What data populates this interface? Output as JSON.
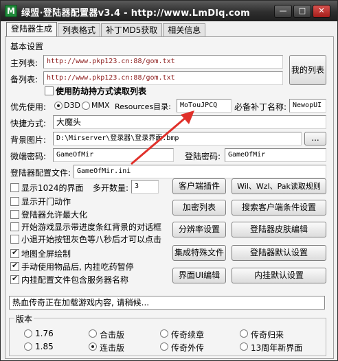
{
  "window": {
    "title": "绿盟·登陆器配置器v3.4 - http://www.LmDlq.com",
    "minimize_glyph": "—",
    "maximize_glyph": "□",
    "close_glyph": "✕",
    "icon_letter": "M"
  },
  "tabs": [
    {
      "label": "登陆器生成",
      "active": true
    },
    {
      "label": "列表格式"
    },
    {
      "label": "补丁MD5获取"
    },
    {
      "label": "相关信息"
    }
  ],
  "basic": {
    "section_label": "基本设置",
    "main_list_label": "主列表:",
    "main_list_value": "http://www.pkp123.cn:88/gom.txt",
    "backup_list_label": "备列表:",
    "backup_list_value": "http://www.pkp123.cn:88/gom.txt",
    "my_list_button": "我的列表",
    "anti_hijack_label": "使用防劫持方式读取列表"
  },
  "priority": {
    "label": "优先使用:",
    "opt1": "D3D",
    "opt2": "MMX",
    "resources_label": "Resources目录:",
    "resources_value": "MoTouJPCQ",
    "patch_label": "必备补丁名称:",
    "patch_value": "NewopUI"
  },
  "shortcut": {
    "label": "快捷方式:",
    "value": "大魔头"
  },
  "background": {
    "label": "背景图片:",
    "value": "D:\\Mirserver\\登录器\\登录界面.bmp",
    "browse": "..."
  },
  "micro_pwd": {
    "label": "微端密码:",
    "value": "GameOfMir"
  },
  "login_pwd": {
    "label": "登陆密码:",
    "value": "GameOfMir"
  },
  "config_file": {
    "label": "登陆器配置文件:",
    "value": "GameOfMir.ini"
  },
  "options": [
    {
      "label": "显示1024的界面",
      "checked": false
    },
    {
      "label": "显示开门动作",
      "checked": false
    },
    {
      "label": "登陆器允许最大化",
      "checked": false
    },
    {
      "label": "开始游戏显示带进度条红背景的对话框",
      "checked": false
    },
    {
      "label": "小退开始按钮灰色等八秒后才可以点击",
      "checked": false
    },
    {
      "label": "地图全屏绘制",
      "checked": true
    },
    {
      "label": "手动使用物品后, 内挂吃药暂停",
      "checked": true
    },
    {
      "label": "内挂配置文件包含服务器名称",
      "checked": true
    }
  ],
  "multi_open": {
    "label": "多开数量:",
    "value": "3"
  },
  "buttons": {
    "client_plugin": "客户端插件",
    "wil_read_rule": "Wil、Wzl、Pak读取规则",
    "encrypt_list": "加密列表",
    "search_client": "搜索客户端条件设置",
    "resolution": "分辨率设置",
    "skin_edit": "登陆器皮肤编辑",
    "special_files": "集成特殊文件",
    "login_default": "登陆器默认设置",
    "ui_edit": "界面UI编辑",
    "plugin_default": "内挂默认设置"
  },
  "status_text": "热血传奇正在加载游戏内容, 请稍候...",
  "version": {
    "label": "版本",
    "options": [
      {
        "label": "1.76",
        "checked": false
      },
      {
        "label": "合击版",
        "checked": false
      },
      {
        "label": "传奇续章",
        "checked": false
      },
      {
        "label": "传奇归来",
        "checked": false
      },
      {
        "label": "1.85",
        "checked": false
      },
      {
        "label": "连击版",
        "checked": true
      },
      {
        "label": "传奇外传",
        "checked": false
      },
      {
        "label": "13周年新界面",
        "checked": false
      }
    ]
  },
  "colors": {
    "arrow": "#e0302a",
    "url_text": "#8b1a1a",
    "titlebar": "#2e2e2e"
  }
}
